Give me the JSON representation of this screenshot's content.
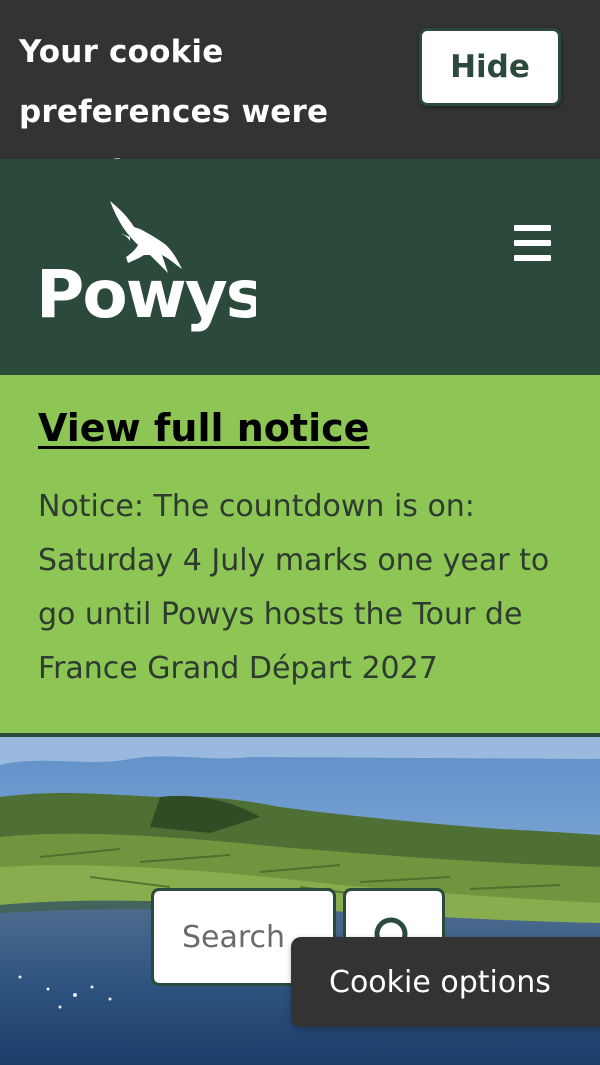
{
  "cookie_banner": {
    "message": "Your cookie preferences were saved",
    "hide_label": "Hide"
  },
  "header": {
    "logo_text": "Powys",
    "menu_icon": "hamburger-menu-icon"
  },
  "notice": {
    "link_label": "View full notice",
    "text": "Notice: The countdown is on: Saturday 4 July marks one year to go until Powys hosts the Tour de France Grand Départ 2027"
  },
  "search": {
    "placeholder": "Search",
    "button_icon": "search-icon"
  },
  "cookie_options": {
    "label": "Cookie options"
  },
  "colors": {
    "header_green": "#2b4a3b",
    "notice_green": "#8dc654",
    "banner_dark": "#333333"
  }
}
